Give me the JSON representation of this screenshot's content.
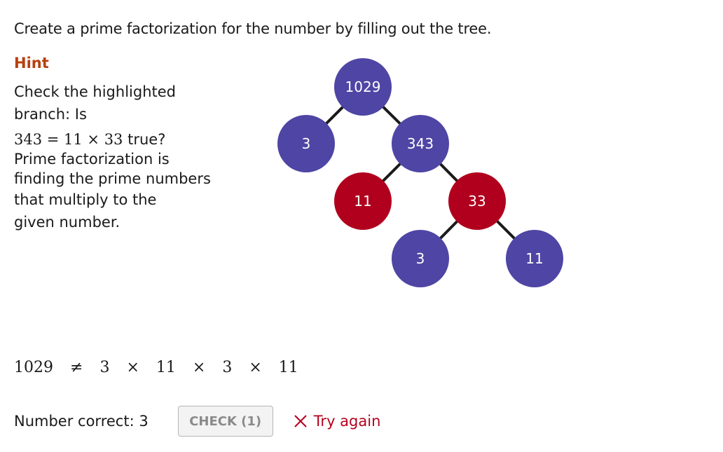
{
  "prompt": "Create a prime factorization for the number by filling out the tree.",
  "hint": {
    "title": "Hint",
    "line1": "Check the highlighted",
    "line2": "branch: Is",
    "math": "343 = 11 × 33",
    "math_suffix": " true?",
    "line3": "Prime factorization is",
    "line4": "finding the prime numbers",
    "line5": "that multiply to the",
    "line6": "given number."
  },
  "colors": {
    "node_default": "#4e45a4",
    "node_highlighted": "#b0001e",
    "edge": "#1a1a1a",
    "hint_title": "#b8400f",
    "error": "#b5001e"
  },
  "tree": {
    "nodes": [
      {
        "id": "root",
        "value": "1029",
        "highlighted": false
      },
      {
        "id": "l1-left",
        "value": "3",
        "highlighted": false
      },
      {
        "id": "l1-right",
        "value": "343",
        "highlighted": false
      },
      {
        "id": "l2-left",
        "value": "11",
        "highlighted": true
      },
      {
        "id": "l2-right",
        "value": "33",
        "highlighted": true
      },
      {
        "id": "l3-left",
        "value": "3",
        "highlighted": false
      },
      {
        "id": "l3-right",
        "value": "11",
        "highlighted": false
      }
    ],
    "edges": [
      [
        "root",
        "l1-left"
      ],
      [
        "root",
        "l1-right"
      ],
      [
        "l1-right",
        "l2-left"
      ],
      [
        "l1-right",
        "l2-right"
      ],
      [
        "l2-right",
        "l3-left"
      ],
      [
        "l2-right",
        "l3-right"
      ]
    ]
  },
  "equation": {
    "lhs": "1029",
    "relation": "≠",
    "terms": [
      "3",
      "11",
      "3",
      "11"
    ],
    "operator": "×"
  },
  "footer": {
    "score_label": "Number correct: 3",
    "check_button": "CHECK (1)",
    "feedback": "Try again",
    "feedback_icon": "x-icon"
  }
}
